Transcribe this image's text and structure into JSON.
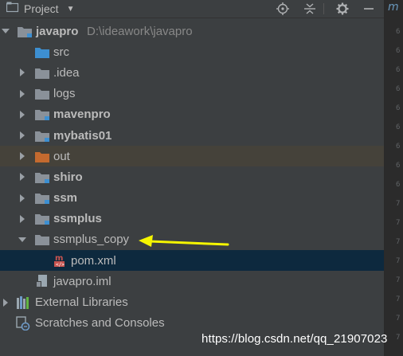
{
  "header": {
    "title": "Project",
    "tools": {
      "locate": "target-icon",
      "collapse": "collapse-all-icon",
      "settings": "gear-icon",
      "hide": "minimize-icon"
    }
  },
  "editor": {
    "tab_label": "m",
    "line_numbers": [
      "6",
      "6",
      "6",
      "6",
      "6",
      "6",
      "6",
      "6",
      "6",
      "7",
      "7",
      "7",
      "7",
      "7",
      "7",
      "7",
      "7"
    ]
  },
  "tree": {
    "root": {
      "name": "javapro",
      "path": "D:\\ideawork\\javapro"
    },
    "items": [
      {
        "label": "src",
        "bold": false,
        "expanded": null,
        "icon": "folder-blue-icon"
      },
      {
        "label": ".idea",
        "bold": false,
        "expanded": false,
        "icon": "folder-icon"
      },
      {
        "label": "logs",
        "bold": false,
        "expanded": false,
        "icon": "folder-icon"
      },
      {
        "label": "mavenpro",
        "bold": true,
        "expanded": false,
        "icon": "module-folder-icon"
      },
      {
        "label": "mybatis01",
        "bold": true,
        "expanded": false,
        "icon": "module-folder-icon"
      },
      {
        "label": "out",
        "bold": false,
        "expanded": false,
        "icon": "folder-orange-icon"
      },
      {
        "label": "shiro",
        "bold": true,
        "expanded": false,
        "icon": "module-folder-icon"
      },
      {
        "label": "ssm",
        "bold": true,
        "expanded": false,
        "icon": "module-folder-icon"
      },
      {
        "label": "ssmplus",
        "bold": true,
        "expanded": false,
        "icon": "module-folder-icon"
      },
      {
        "label": "ssmplus_copy",
        "bold": false,
        "expanded": true,
        "icon": "folder-icon"
      },
      {
        "label": "pom.xml",
        "bold": false,
        "expanded": null,
        "icon": "maven-file-icon"
      },
      {
        "label": "javapro.iml",
        "bold": false,
        "expanded": null,
        "icon": "iml-file-icon"
      },
      {
        "label": "External Libraries",
        "bold": false,
        "expanded": false,
        "icon": "libraries-icon"
      },
      {
        "label": "Scratches and Consoles",
        "bold": false,
        "expanded": null,
        "icon": "scratches-icon"
      }
    ]
  },
  "watermark": "https://blog.csdn.net/qq_21907023",
  "colors": {
    "background": "#3c3f41",
    "selection": "#0d293e",
    "out_row": "#45423a",
    "annotation_arrow": "#f5f500",
    "folder": "#8a9199",
    "folder_blue": "#3d8fd1",
    "folder_orange": "#c46a2f"
  }
}
